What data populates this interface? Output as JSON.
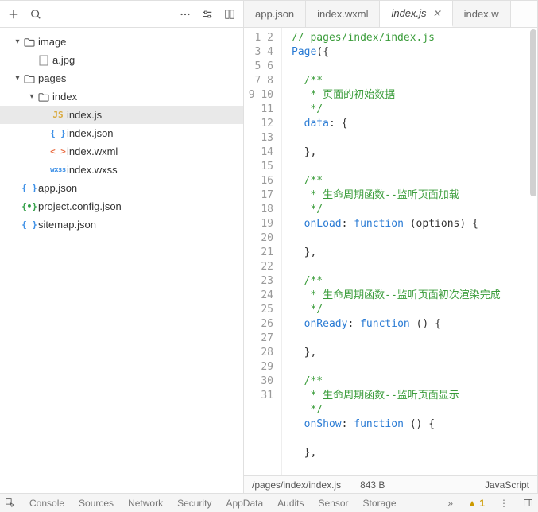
{
  "sidebar": {
    "topIcons": {
      "add": "plus-icon",
      "search": "search-icon",
      "more": "more-icon",
      "settings1": "sliders-icon",
      "settings2": "columns-icon"
    },
    "tree": [
      {
        "type": "folder",
        "name": "image",
        "depth": 0,
        "expanded": true
      },
      {
        "type": "file",
        "name": "a.jpg",
        "depth": 1,
        "kind": "image"
      },
      {
        "type": "folder",
        "name": "pages",
        "depth": 0,
        "expanded": true
      },
      {
        "type": "folder",
        "name": "index",
        "depth": 1,
        "expanded": true
      },
      {
        "type": "file",
        "name": "index.js",
        "depth": 2,
        "kind": "js",
        "active": true
      },
      {
        "type": "file",
        "name": "index.json",
        "depth": 2,
        "kind": "json"
      },
      {
        "type": "file",
        "name": "index.wxml",
        "depth": 2,
        "kind": "wxml"
      },
      {
        "type": "file",
        "name": "index.wxss",
        "depth": 2,
        "kind": "wxss"
      },
      {
        "type": "file",
        "name": "app.json",
        "depth": 0,
        "kind": "json"
      },
      {
        "type": "file",
        "name": "project.config.json",
        "depth": 0,
        "kind": "config"
      },
      {
        "type": "file",
        "name": "sitemap.json",
        "depth": 0,
        "kind": "json"
      }
    ]
  },
  "tabs": [
    {
      "label": "app.json",
      "active": false
    },
    {
      "label": "index.wxml",
      "active": false
    },
    {
      "label": "index.js",
      "active": true,
      "closable": true
    },
    {
      "label": "index.w",
      "active": false,
      "truncated": true
    }
  ],
  "code": {
    "lines": [
      [
        {
          "c": "comment",
          "t": "// pages/index/index.js"
        }
      ],
      [
        {
          "c": "ident",
          "t": "Page"
        },
        {
          "c": "plain",
          "t": "({"
        }
      ],
      [],
      [
        {
          "c": "comment",
          "t": "  /**"
        }
      ],
      [
        {
          "c": "comment",
          "t": "   * 页面的初始数据"
        }
      ],
      [
        {
          "c": "comment",
          "t": "   */"
        }
      ],
      [
        {
          "c": "plain",
          "t": "  "
        },
        {
          "c": "ident",
          "t": "data"
        },
        {
          "c": "plain",
          "t": ": {"
        }
      ],
      [],
      [
        {
          "c": "plain",
          "t": "  },"
        }
      ],
      [],
      [
        {
          "c": "comment",
          "t": "  /**"
        }
      ],
      [
        {
          "c": "comment",
          "t": "   * 生命周期函数--监听页面加载"
        }
      ],
      [
        {
          "c": "comment",
          "t": "   */"
        }
      ],
      [
        {
          "c": "plain",
          "t": "  "
        },
        {
          "c": "ident",
          "t": "onLoad"
        },
        {
          "c": "plain",
          "t": ": "
        },
        {
          "c": "kw",
          "t": "function"
        },
        {
          "c": "plain",
          "t": " (options) {"
        }
      ],
      [],
      [
        {
          "c": "plain",
          "t": "  },"
        }
      ],
      [],
      [
        {
          "c": "comment",
          "t": "  /**"
        }
      ],
      [
        {
          "c": "comment",
          "t": "   * 生命周期函数--监听页面初次渲染完成"
        }
      ],
      [
        {
          "c": "comment",
          "t": "   */"
        }
      ],
      [
        {
          "c": "plain",
          "t": "  "
        },
        {
          "c": "ident",
          "t": "onReady"
        },
        {
          "c": "plain",
          "t": ": "
        },
        {
          "c": "kw",
          "t": "function"
        },
        {
          "c": "plain",
          "t": " () {"
        }
      ],
      [],
      [
        {
          "c": "plain",
          "t": "  },"
        }
      ],
      [],
      [
        {
          "c": "comment",
          "t": "  /**"
        }
      ],
      [
        {
          "c": "comment",
          "t": "   * 生命周期函数--监听页面显示"
        }
      ],
      [
        {
          "c": "comment",
          "t": "   */"
        }
      ],
      [
        {
          "c": "plain",
          "t": "  "
        },
        {
          "c": "ident",
          "t": "onShow"
        },
        {
          "c": "plain",
          "t": ": "
        },
        {
          "c": "kw",
          "t": "function"
        },
        {
          "c": "plain",
          "t": " () {"
        }
      ],
      [],
      [
        {
          "c": "plain",
          "t": "  },"
        }
      ],
      []
    ]
  },
  "status": {
    "path": "/pages/index/index.js",
    "size": "843 B",
    "lang": "JavaScript"
  },
  "bottom": {
    "items": [
      "Console",
      "Sources",
      "Network",
      "Security",
      "AppData",
      "Audits",
      "Sensor",
      "Storage"
    ],
    "warnCount": "1"
  }
}
